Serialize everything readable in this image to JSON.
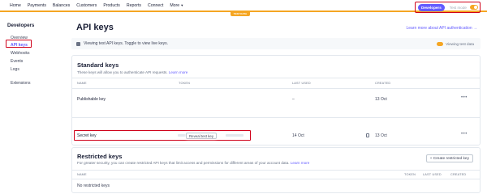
{
  "nav": {
    "items": [
      "Home",
      "Payments",
      "Balances",
      "Customers",
      "Products",
      "Reports",
      "Connect",
      "More"
    ],
    "test_data_tab": "TEST DATA",
    "developers_label": "Developers",
    "test_mode_label": "Test mode",
    "test_mode_on": true,
    "accent_color": "#635bff",
    "test_color": "#f5a623"
  },
  "sidebar": {
    "title": "Developers",
    "items": [
      "Overview",
      "API keys",
      "Webhooks",
      "Events",
      "Logs",
      "Extensions"
    ],
    "active": "API keys"
  },
  "main": {
    "title": "API keys",
    "learn_more_auth": "Learn more about API authentication →",
    "banner_text": "Viewing test API keys. Toggle to view live keys.",
    "banner_toggle_label": "Viewing test data",
    "standard": {
      "title": "Standard keys",
      "subtitle": "These keys will allow you to authenticate API requests.",
      "learn_more": "Learn more",
      "columns": [
        "NAME",
        "TOKEN",
        "LAST USED",
        "CREATED"
      ],
      "rows": [
        {
          "name": "Publishable key",
          "token": "",
          "last_used": "–",
          "created": "13 Oct"
        },
        {
          "name": "Secret key",
          "token_button": "Reveal test key",
          "last_used": "14 Oct",
          "created": "13 Oct"
        }
      ]
    },
    "restricted": {
      "title": "Restricted keys",
      "subtitle": "For greater security, you can create restricted API keys that limit access and permissions for different areas of your account data.",
      "learn_more": "Learn more",
      "create_button": "+ Create restricted key",
      "columns": [
        "NAME",
        "TOKEN",
        "LAST USED",
        "CREATED"
      ],
      "empty_text": "No restricted keys"
    }
  }
}
